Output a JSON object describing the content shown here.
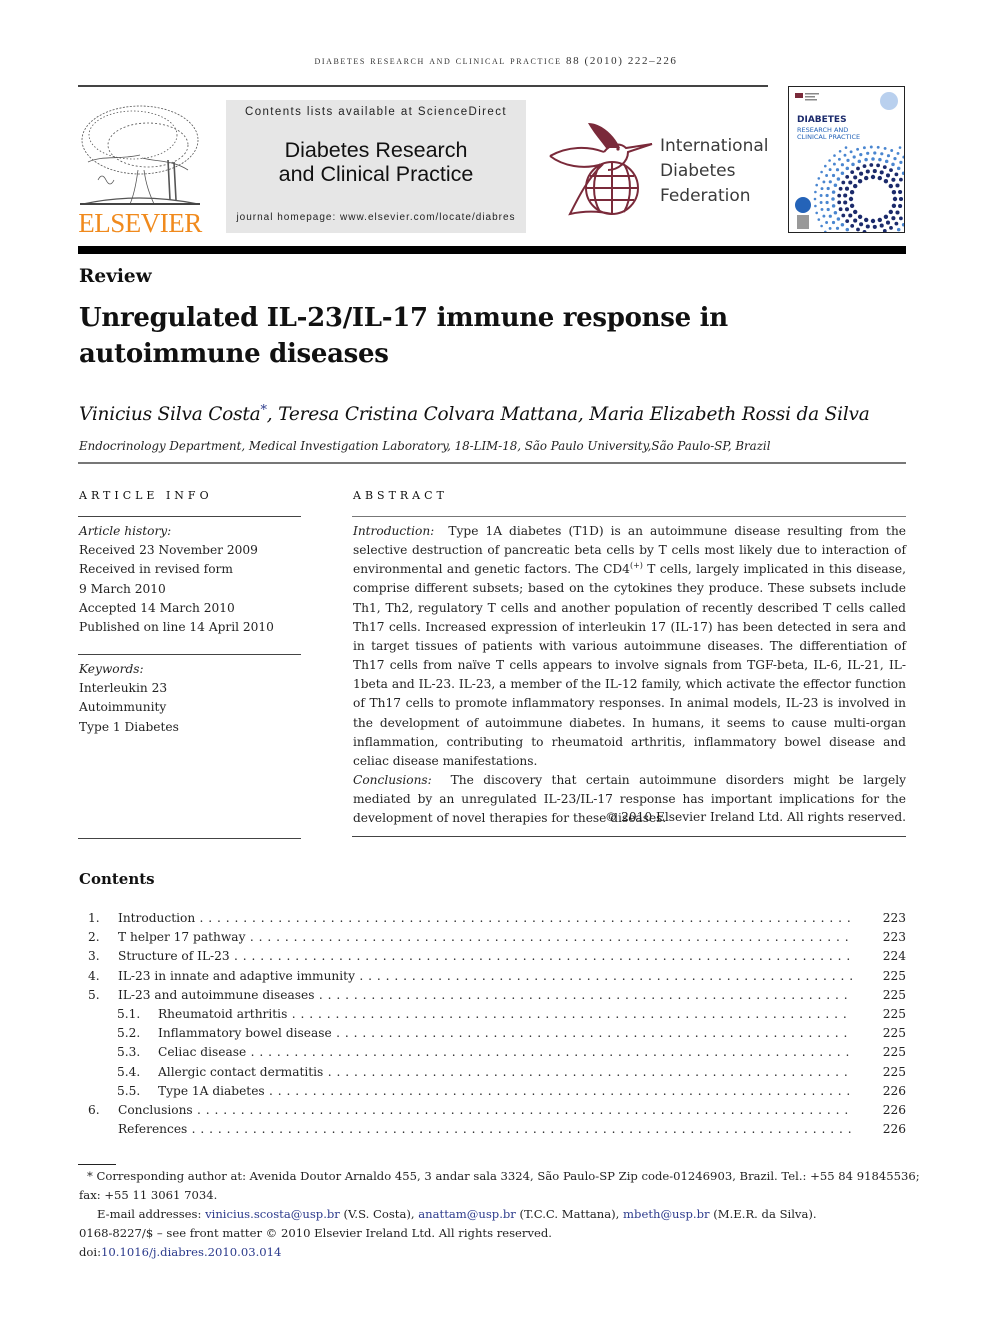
{
  "running_header": "DIABETES RESEARCH AND CLINICAL PRACTICE 88 (2010) 222–226",
  "masthead": {
    "publisher_logo_text": "ELSEVIER",
    "sciencedirect_line": "Contents lists available at ScienceDirect",
    "journal_name_line1": "Diabetes Research",
    "journal_name_line2": "and Clinical Practice",
    "homepage_line": "journal homepage: www.elsevier.com/locate/diabres",
    "society_name": [
      "International",
      "Diabetes",
      "Federation"
    ],
    "cover": {
      "title": "DIABETES",
      "subtitle_line1": "RESEARCH AND",
      "subtitle_line2": "CLINICAL PRACTICE"
    },
    "colors": {
      "elsevier_orange": "#f08a1d",
      "idf_maroon": "#7a2a3a",
      "cover_blue": "#2463b8",
      "link_blue": "#2b3a8c"
    }
  },
  "article": {
    "type": "Review",
    "title": "Unregulated IL-23/IL-17 immune response in autoimmune diseases",
    "authors": [
      {
        "name": "Vinicius Silva Costa",
        "corresponding": true
      },
      {
        "name": "Teresa Cristina Colvara Mattana",
        "corresponding": false
      },
      {
        "name": "Maria Elizabeth Rossi da Silva",
        "corresponding": false
      }
    ],
    "author_sep": ", ",
    "corresponding_mark": "*",
    "affiliation": "Endocrinology Department, Medical Investigation Laboratory, 18-LIM-18, São Paulo University,São Paulo-SP, Brazil"
  },
  "article_info": {
    "heading": "ARTICLE INFO",
    "history_label": "Article history:",
    "history": [
      "Received 23 November 2009",
      "Received in revised form",
      "9 March 2010",
      "Accepted 14 March 2010",
      "Published on line 14 April 2010"
    ],
    "keywords_label": "Keywords:",
    "keywords": [
      "Interleukin 23",
      "Autoimmunity",
      "Type 1 Diabetes"
    ]
  },
  "abstract": {
    "heading": "ABSTRACT",
    "intro_label": "Introduction:",
    "intro_text_a": "Type 1A diabetes (T1D) is an autoimmune disease resulting from the selective destruction of pancreatic beta cells by T cells most likely due to interaction of environmental and genetic factors. The CD4",
    "intro_sup": "(+)",
    "intro_text_b": " T cells, largely implicated in this disease, comprise different subsets; based on the cytokines they produce. These subsets include Th1, Th2, regulatory T cells and another population of recently described T cells called Th17 cells. Increased expression of interleukin 17 (IL-17) has been detected in sera and in target tissues of patients with various autoimmune diseases. The differentiation of Th17 cells from naïve T cells appears to involve signals from TGF-beta, IL-6, IL-21, IL-1beta and IL-23. IL-23, a member of the IL-12 family, which activate the effector function of Th17 cells to promote inflammatory responses. In animal models, IL-23 is involved in the development of autoimmune diabetes. In humans, it seems to cause multi-organ inflammation, contributing to rheumatoid arthritis, inflammatory bowel disease and celiac disease manifestations.",
    "conclusions_label": "Conclusions:",
    "conclusions_text": "The discovery that certain autoimmune disorders might be largely mediated by an unregulated IL-23/IL-17 response has important implications for the development of novel therapies for these diseases.",
    "copyright": "© 2010 Elsevier Ireland Ltd. All rights reserved."
  },
  "contents": {
    "heading": "Contents",
    "items": [
      {
        "num": "1.",
        "title": "Introduction",
        "page": "223",
        "level": 1
      },
      {
        "num": "2.",
        "title": "T helper 17 pathway",
        "page": "223",
        "level": 1
      },
      {
        "num": "3.",
        "title": "Structure of IL-23",
        "page": "224",
        "level": 1
      },
      {
        "num": "4.",
        "title": "IL-23 in innate and adaptive immunity",
        "page": "225",
        "level": 1
      },
      {
        "num": "5.",
        "title": "IL-23 and autoimmune diseases",
        "page": "225",
        "level": 1
      },
      {
        "num": "5.1.",
        "title": "Rheumatoid arthritis",
        "page": "225",
        "level": 2
      },
      {
        "num": "5.2.",
        "title": "Inflammatory bowel disease",
        "page": "225",
        "level": 2
      },
      {
        "num": "5.3.",
        "title": "Celiac disease",
        "page": "225",
        "level": 2
      },
      {
        "num": "5.4.",
        "title": "Allergic contact dermatitis",
        "page": "225",
        "level": 2
      },
      {
        "num": "5.5.",
        "title": "Type 1A diabetes",
        "page": "226",
        "level": 2
      },
      {
        "num": "6.",
        "title": "Conclusions",
        "page": "226",
        "level": 1
      },
      {
        "num": "",
        "title": "References",
        "page": "226",
        "level": 1
      }
    ]
  },
  "footnotes": {
    "corresponding_line1": "* Corresponding author at: Avenida Doutor Arnaldo 455, 3 andar sala 3324, São Paulo-SP Zip code-01246903, Brazil. Tel.: +55 84 91845536;",
    "corresponding_line2": "fax: +55 11 3061 7034.",
    "email_label": "E-mail addresses:",
    "emails": [
      {
        "address": "vinicius.scosta@usp.br",
        "who": " (V.S. Costa), "
      },
      {
        "address": "anattam@usp.br",
        "who": " (T.C.C. Mattana), "
      },
      {
        "address": "mbeth@usp.br",
        "who": " (M.E.R. da Silva)."
      }
    ],
    "issn_line": "0168-8227/$ – see front matter © 2010 Elsevier Ireland Ltd. All rights reserved.",
    "doi_prefix": "doi:",
    "doi": "10.1016/j.diabres.2010.03.014"
  }
}
